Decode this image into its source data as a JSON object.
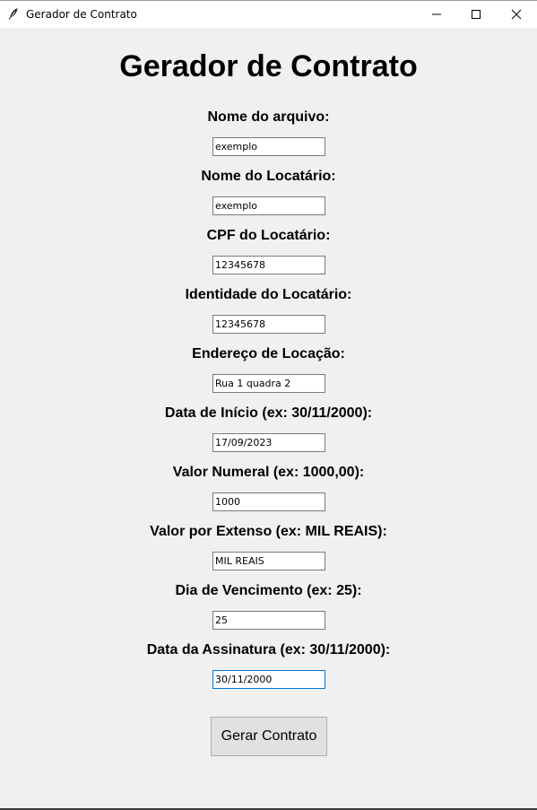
{
  "window": {
    "title": "Gerador de Contrato",
    "icon": "feather-icon"
  },
  "main": {
    "heading": "Gerador de Contrato",
    "fields": [
      {
        "label": "Nome do arquivo:",
        "value": "exemplo"
      },
      {
        "label": "Nome do Locatário:",
        "value": "exemplo"
      },
      {
        "label": "CPF do Locatário:",
        "value": "12345678"
      },
      {
        "label": "Identidade do Locatário:",
        "value": "12345678"
      },
      {
        "label": "Endereço de Locação:",
        "value": "Rua 1 quadra 2"
      },
      {
        "label": "Data de Início (ex: 30/11/2000):",
        "value": "17/09/2023"
      },
      {
        "label": "Valor Numeral (ex: 1000,00):",
        "value": "1000"
      },
      {
        "label": "Valor por Extenso (ex: MIL REAIS):",
        "value": "MIL REAIS"
      },
      {
        "label": "Dia de Vencimento (ex: 25):",
        "value": "25"
      },
      {
        "label": "Data da Assinatura (ex: 30/11/2000):",
        "value": "30/11/2000"
      }
    ],
    "button_label": "Gerar Contrato"
  },
  "colors": {
    "background": "#f0f0f0",
    "focus_border": "#0078d7",
    "button_bg": "#e1e1e1"
  }
}
